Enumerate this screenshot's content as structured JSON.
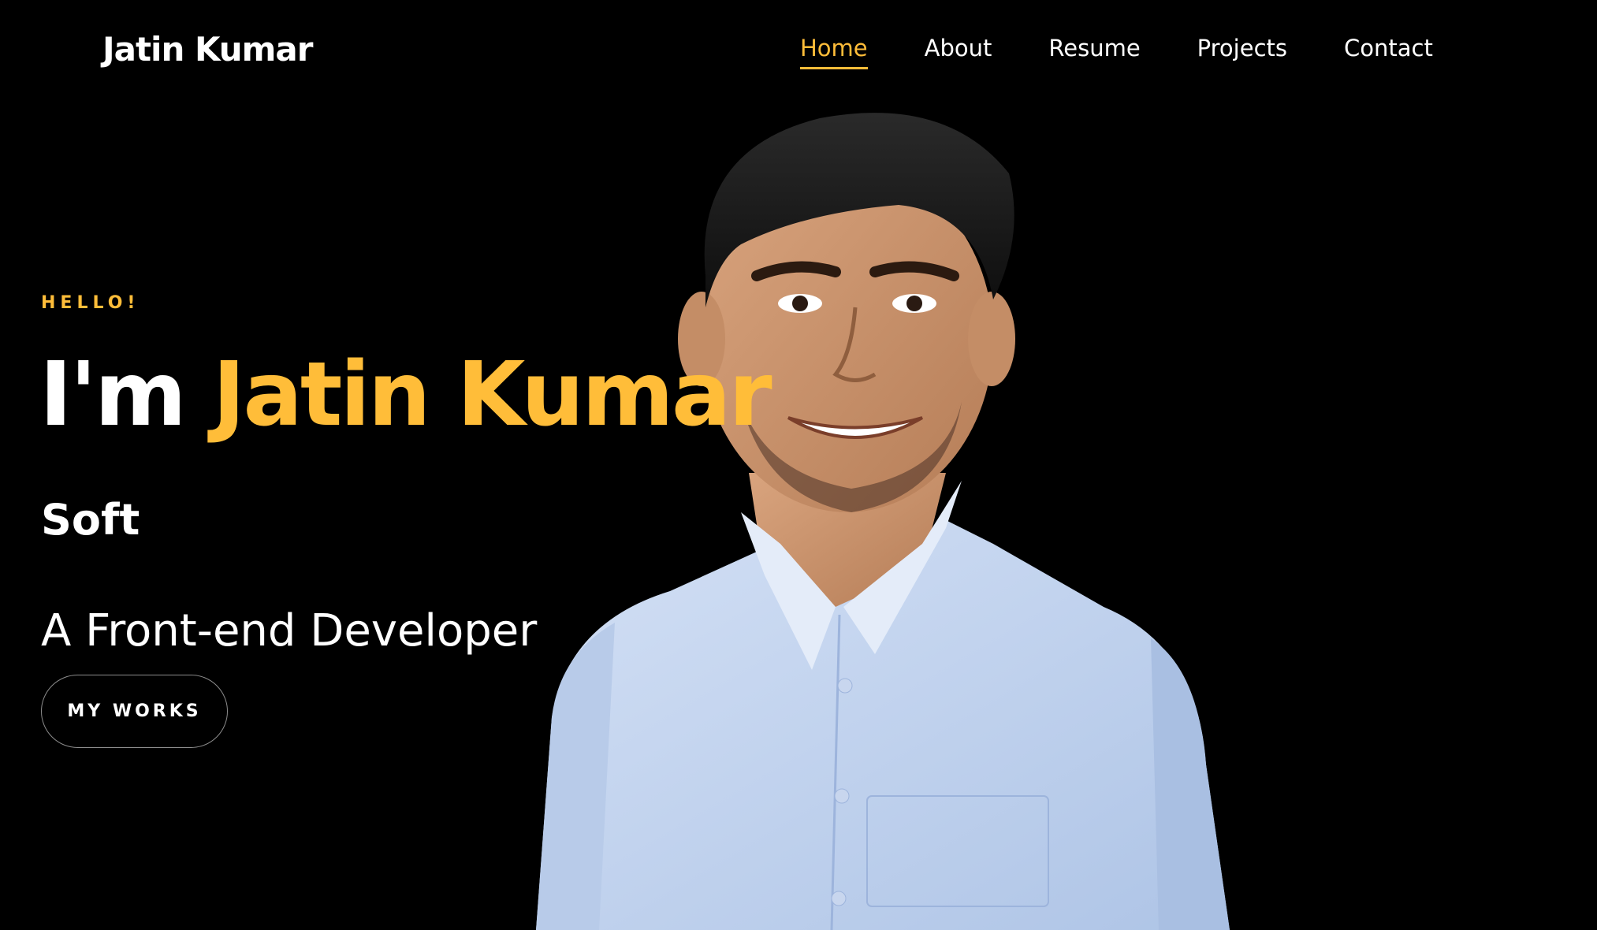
{
  "header": {
    "logo": "Jatin Kumar",
    "nav": [
      {
        "label": "Home",
        "active": true
      },
      {
        "label": "About",
        "active": false
      },
      {
        "label": "Resume",
        "active": false
      },
      {
        "label": "Projects",
        "active": false
      },
      {
        "label": "Contact",
        "active": false
      }
    ]
  },
  "hero": {
    "greeting": "HELLO!",
    "headline_prefix": "I'm",
    "headline_name": "Jatin Kumar",
    "typed_text": "Soft",
    "role": "A Front-end Developer",
    "cta_label": "MY WORKS"
  },
  "colors": {
    "accent": "#ffbd39",
    "background": "#000000",
    "text": "#ffffff",
    "shirt": "#c9d9f2"
  },
  "icons": {
    "portrait": "person-photo"
  }
}
